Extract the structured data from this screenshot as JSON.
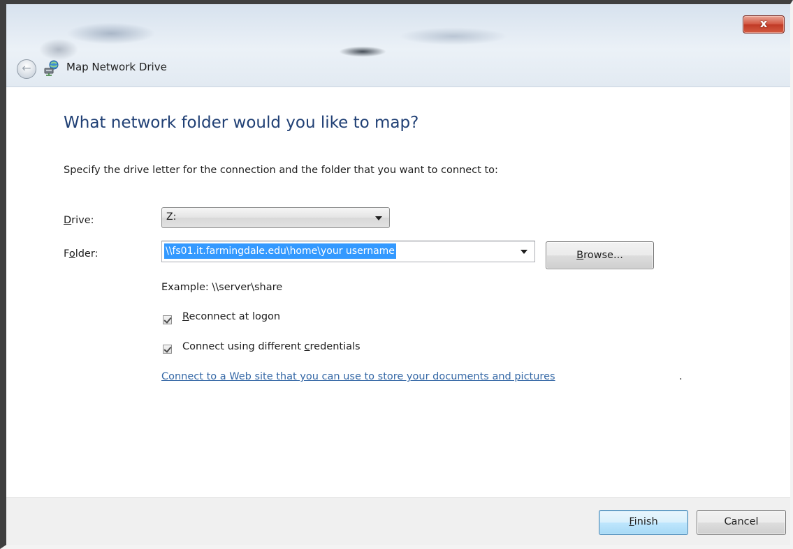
{
  "window": {
    "title": "Map Network Drive",
    "close_glyph": "x",
    "back_icon": "back-arrow-icon",
    "app_icon": "network-drive-icon"
  },
  "main": {
    "heading": "What network folder would you like to map?",
    "instruction": "Specify the drive letter for the connection and the folder that you want to connect to:",
    "drive": {
      "label_key": "D",
      "label_rest": "rive:",
      "value": "Z:"
    },
    "folder": {
      "label_pre": "F",
      "label_key": "o",
      "label_rest": "lder:",
      "value": "\\\\fs01.it.farmingdale.edu\\home\\your username"
    },
    "browse_button": {
      "key": "B",
      "rest": "rowse..."
    },
    "example": "Example: \\\\server\\share",
    "reconnect": {
      "checked": true,
      "key": "R",
      "rest": "econnect at logon"
    },
    "credentials": {
      "checked": true,
      "pre": "Connect using different ",
      "key": "c",
      "rest": "redentials"
    },
    "web_link": "Connect to a Web site that you can use to store your documents and pictures",
    "web_link_suffix": "."
  },
  "footer": {
    "finish_key": "F",
    "finish_rest": "inish",
    "cancel": "Cancel"
  },
  "colors": {
    "heading": "#1f3f74",
    "link": "#3568a6",
    "selection": "#3399ff",
    "close_button": "#c8432f"
  }
}
